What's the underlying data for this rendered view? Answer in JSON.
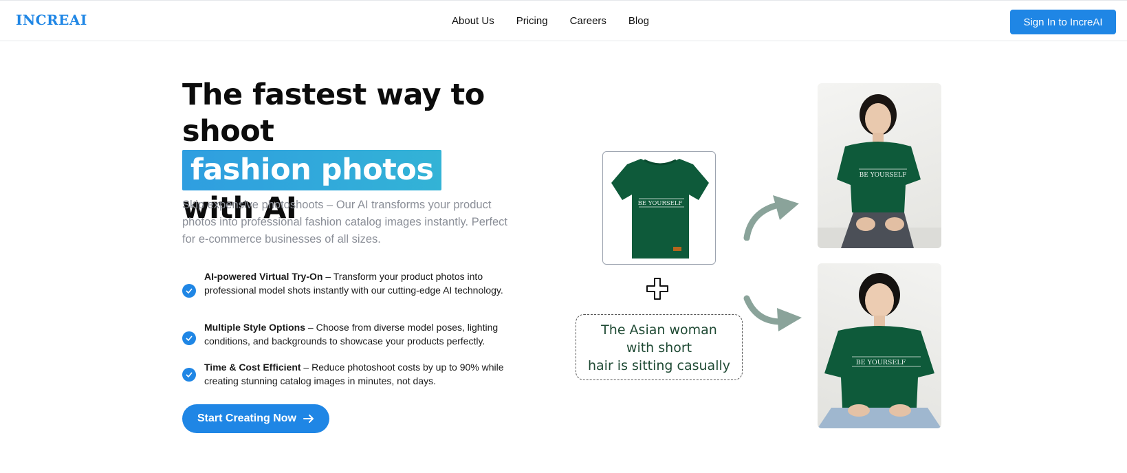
{
  "header": {
    "logo": "INCREAI",
    "nav": [
      "About Us",
      "Pricing",
      "Careers",
      "Blog"
    ],
    "signin_label": "Sign In to IncreAI"
  },
  "hero": {
    "headline_line1": "The fastest way to",
    "headline_shoot": "shoot",
    "headline_highlight": "fashion photos",
    "headline_line3": "with AI",
    "subtitle": "Skip expensive photoshoots – Our AI transforms your product photos into professional fashion catalog images instantly. Perfect for e-commerce businesses of all sizes.",
    "features": [
      {
        "title": "AI-powered Virtual Try-On",
        "text": " – Transform your product photos into professional model shots instantly with our cutting-edge AI technology."
      },
      {
        "title": "Multiple Style Options",
        "text": " – Choose from diverse model poses, lighting conditions, and backgrounds to showcase your products perfectly."
      },
      {
        "title": "Time & Cost Efficient",
        "text": " – Reduce photoshoot costs by up to 90% while creating stunning catalog images in minutes, not days."
      }
    ],
    "cta_label": "Start Creating Now"
  },
  "visual": {
    "shirt_print": "BE YOURSELF",
    "prompt_lines": [
      "The Asian woman",
      "with short",
      "hair is sitting casually"
    ]
  },
  "colors": {
    "accent": "#1f86e5",
    "highlight": "#2f9ee0",
    "shirt_green": "#0e5a3a",
    "arrow": "#8aa39a"
  }
}
